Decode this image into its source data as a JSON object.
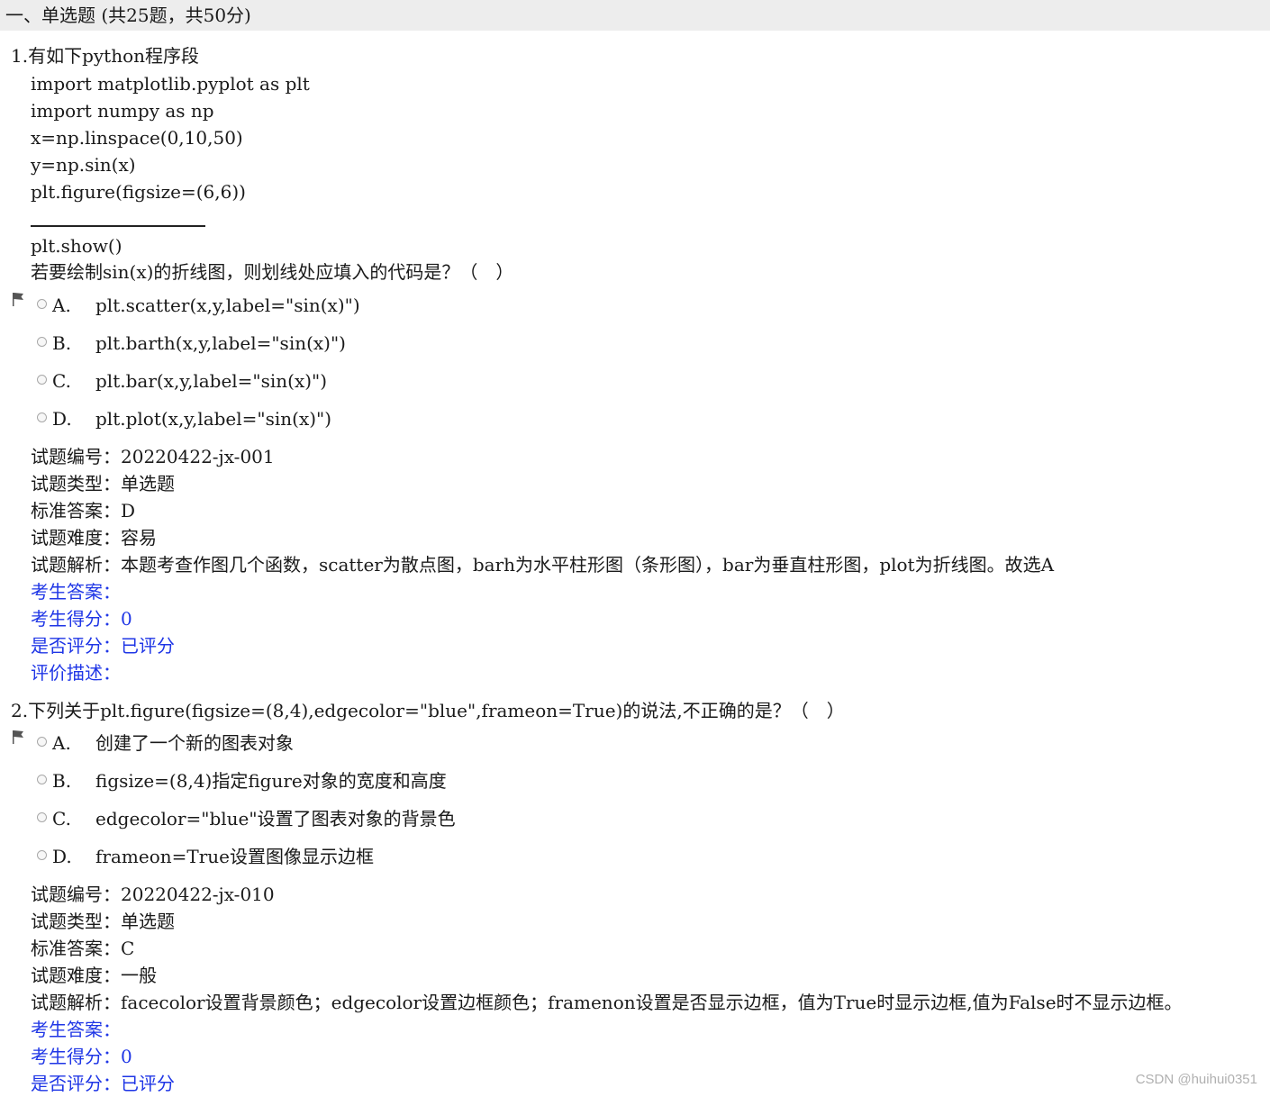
{
  "section": {
    "title": "一、单选题 (共25题，共50分)"
  },
  "q1": {
    "stem": "1.有如下python程序段",
    "code": [
      "import matplotlib.pyplot as plt",
      "import numpy as np",
      "x=np.linspace(0,10,50)",
      "y=np.sin(x)",
      "plt.figure(figsize=(6,6))"
    ],
    "after_blank": "plt.show()",
    "question": "若要绘制sin(x)的折线图，则划线处应填入的代码是？（　）",
    "options": [
      {
        "letter": "A.",
        "text": "plt.scatter(x,y,label=\"sin(x)\")"
      },
      {
        "letter": "B.",
        "text": "plt.barth(x,y,label=\"sin(x)\")"
      },
      {
        "letter": "C.",
        "text": "plt.bar(x,y,label=\"sin(x)\")"
      },
      {
        "letter": "D.",
        "text": "plt.plot(x,y,label=\"sin(x)\")"
      }
    ],
    "info": {
      "id": "试题编号：20220422-jx-001",
      "type": "试题类型：单选题",
      "answer": "标准答案：D",
      "difficulty": "试题难度：容易",
      "analysis": "试题解析：本题考查作图几个函数，scatter为散点图，barh为水平柱形图（条形图），bar为垂直柱形图，plot为折线图。故选A"
    },
    "grading": {
      "student_answer": "考生答案：",
      "score": "考生得分：0",
      "graded": "是否评分：已评分",
      "comment": "评价描述："
    }
  },
  "q2": {
    "stem": "2.下列关于plt.figure(figsize=(8,4),edgecolor=\"blue\",frameon=True)的说法,不正确的是？（　）",
    "options": [
      {
        "letter": "A.",
        "text": "创建了一个新的图表对象"
      },
      {
        "letter": "B.",
        "text": "figsize=(8,4)指定figure对象的宽度和高度"
      },
      {
        "letter": "C.",
        "text": "edgecolor=\"blue\"设置了图表对象的背景色"
      },
      {
        "letter": "D.",
        "text": "frameon=True设置图像显示边框"
      }
    ],
    "info": {
      "id": "试题编号：20220422-jx-010",
      "type": "试题类型：单选题",
      "answer": "标准答案：C",
      "difficulty": "试题难度：一般",
      "analysis": "试题解析：facecolor设置背景颜色；edgecolor设置边框颜色；framenon设置是否显示边框，值为True时显示边框,值为False时不显示边框。"
    },
    "grading": {
      "student_answer": "考生答案：",
      "score": "考生得分：0",
      "graded": "是否评分：已评分"
    }
  },
  "watermark": "CSDN @huihui0351",
  "colors": {
    "blue_text": "#1f36e6",
    "header_bg": "#ededed"
  },
  "icons": {
    "flag": "flag-icon",
    "radio": "radio-button"
  }
}
